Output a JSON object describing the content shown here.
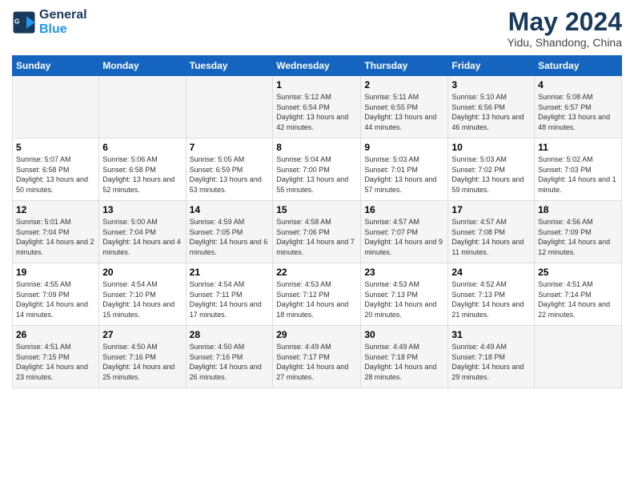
{
  "logo": {
    "line1": "General",
    "line2": "Blue"
  },
  "title": "May 2024",
  "location": "Yidu, Shandong, China",
  "days_of_week": [
    "Sunday",
    "Monday",
    "Tuesday",
    "Wednesday",
    "Thursday",
    "Friday",
    "Saturday"
  ],
  "weeks": [
    [
      {
        "day": "",
        "info": ""
      },
      {
        "day": "",
        "info": ""
      },
      {
        "day": "",
        "info": ""
      },
      {
        "day": "1",
        "info": "Sunrise: 5:12 AM\nSunset: 6:54 PM\nDaylight: 13 hours and 42 minutes."
      },
      {
        "day": "2",
        "info": "Sunrise: 5:11 AM\nSunset: 6:55 PM\nDaylight: 13 hours and 44 minutes."
      },
      {
        "day": "3",
        "info": "Sunrise: 5:10 AM\nSunset: 6:56 PM\nDaylight: 13 hours and 46 minutes."
      },
      {
        "day": "4",
        "info": "Sunrise: 5:08 AM\nSunset: 6:57 PM\nDaylight: 13 hours and 48 minutes."
      }
    ],
    [
      {
        "day": "5",
        "info": "Sunrise: 5:07 AM\nSunset: 6:58 PM\nDaylight: 13 hours and 50 minutes."
      },
      {
        "day": "6",
        "info": "Sunrise: 5:06 AM\nSunset: 6:58 PM\nDaylight: 13 hours and 52 minutes."
      },
      {
        "day": "7",
        "info": "Sunrise: 5:05 AM\nSunset: 6:59 PM\nDaylight: 13 hours and 53 minutes."
      },
      {
        "day": "8",
        "info": "Sunrise: 5:04 AM\nSunset: 7:00 PM\nDaylight: 13 hours and 55 minutes."
      },
      {
        "day": "9",
        "info": "Sunrise: 5:03 AM\nSunset: 7:01 PM\nDaylight: 13 hours and 57 minutes."
      },
      {
        "day": "10",
        "info": "Sunrise: 5:03 AM\nSunset: 7:02 PM\nDaylight: 13 hours and 59 minutes."
      },
      {
        "day": "11",
        "info": "Sunrise: 5:02 AM\nSunset: 7:03 PM\nDaylight: 14 hours and 1 minute."
      }
    ],
    [
      {
        "day": "12",
        "info": "Sunrise: 5:01 AM\nSunset: 7:04 PM\nDaylight: 14 hours and 2 minutes."
      },
      {
        "day": "13",
        "info": "Sunrise: 5:00 AM\nSunset: 7:04 PM\nDaylight: 14 hours and 4 minutes."
      },
      {
        "day": "14",
        "info": "Sunrise: 4:59 AM\nSunset: 7:05 PM\nDaylight: 14 hours and 6 minutes."
      },
      {
        "day": "15",
        "info": "Sunrise: 4:58 AM\nSunset: 7:06 PM\nDaylight: 14 hours and 7 minutes."
      },
      {
        "day": "16",
        "info": "Sunrise: 4:57 AM\nSunset: 7:07 PM\nDaylight: 14 hours and 9 minutes."
      },
      {
        "day": "17",
        "info": "Sunrise: 4:57 AM\nSunset: 7:08 PM\nDaylight: 14 hours and 11 minutes."
      },
      {
        "day": "18",
        "info": "Sunrise: 4:56 AM\nSunset: 7:09 PM\nDaylight: 14 hours and 12 minutes."
      }
    ],
    [
      {
        "day": "19",
        "info": "Sunrise: 4:55 AM\nSunset: 7:09 PM\nDaylight: 14 hours and 14 minutes."
      },
      {
        "day": "20",
        "info": "Sunrise: 4:54 AM\nSunset: 7:10 PM\nDaylight: 14 hours and 15 minutes."
      },
      {
        "day": "21",
        "info": "Sunrise: 4:54 AM\nSunset: 7:11 PM\nDaylight: 14 hours and 17 minutes."
      },
      {
        "day": "22",
        "info": "Sunrise: 4:53 AM\nSunset: 7:12 PM\nDaylight: 14 hours and 18 minutes."
      },
      {
        "day": "23",
        "info": "Sunrise: 4:53 AM\nSunset: 7:13 PM\nDaylight: 14 hours and 20 minutes."
      },
      {
        "day": "24",
        "info": "Sunrise: 4:52 AM\nSunset: 7:13 PM\nDaylight: 14 hours and 21 minutes."
      },
      {
        "day": "25",
        "info": "Sunrise: 4:51 AM\nSunset: 7:14 PM\nDaylight: 14 hours and 22 minutes."
      }
    ],
    [
      {
        "day": "26",
        "info": "Sunrise: 4:51 AM\nSunset: 7:15 PM\nDaylight: 14 hours and 23 minutes."
      },
      {
        "day": "27",
        "info": "Sunrise: 4:50 AM\nSunset: 7:16 PM\nDaylight: 14 hours and 25 minutes."
      },
      {
        "day": "28",
        "info": "Sunrise: 4:50 AM\nSunset: 7:16 PM\nDaylight: 14 hours and 26 minutes."
      },
      {
        "day": "29",
        "info": "Sunrise: 4:49 AM\nSunset: 7:17 PM\nDaylight: 14 hours and 27 minutes."
      },
      {
        "day": "30",
        "info": "Sunrise: 4:49 AM\nSunset: 7:18 PM\nDaylight: 14 hours and 28 minutes."
      },
      {
        "day": "31",
        "info": "Sunrise: 4:49 AM\nSunset: 7:18 PM\nDaylight: 14 hours and 29 minutes."
      },
      {
        "day": "",
        "info": ""
      }
    ]
  ]
}
